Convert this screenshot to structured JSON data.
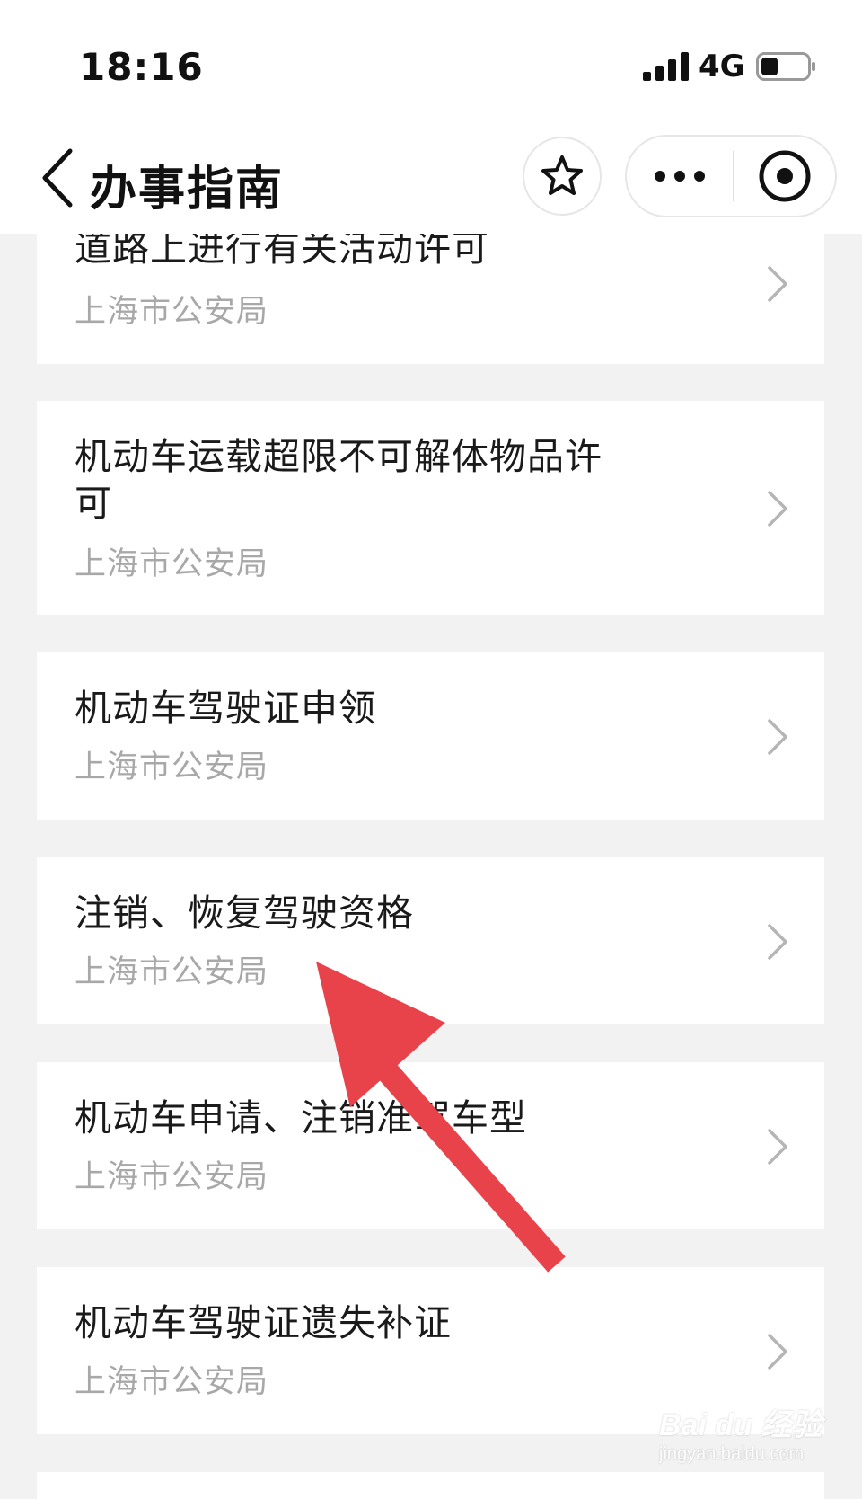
{
  "status_bar": {
    "time": "18:16",
    "network": "4G",
    "signal_bars": 4,
    "battery_level": 0.35
  },
  "nav": {
    "title": "办事指南"
  },
  "items": [
    {
      "title": "道路上进行有关活动许可",
      "agency": "上海市公安局"
    },
    {
      "title": "机动车运载超限不可解体物品许可",
      "agency": "上海市公安局"
    },
    {
      "title": "机动车驾驶证申领",
      "agency": "上海市公安局"
    },
    {
      "title": "注销、恢复驾驶资格",
      "agency": "上海市公安局"
    },
    {
      "title": "机动车申请、注销准驾车型",
      "agency": "上海市公安局"
    },
    {
      "title": "机动车驾驶证遗失补证",
      "agency": "上海市公安局"
    }
  ],
  "watermark": {
    "brand": "Bai du 经验",
    "url": "jingyan.baidu.com"
  },
  "colors": {
    "background": "#f2f2f2",
    "card": "#ffffff",
    "title_text": "#1a1a1a",
    "secondary_text": "#a8a8a8",
    "annotation_arrow": "#e8434b"
  },
  "icons": {
    "back": "chevron-left-icon",
    "favorite": "star-icon",
    "more": "more-dots-icon",
    "close": "target-close-icon",
    "row": "chevron-right-icon"
  }
}
